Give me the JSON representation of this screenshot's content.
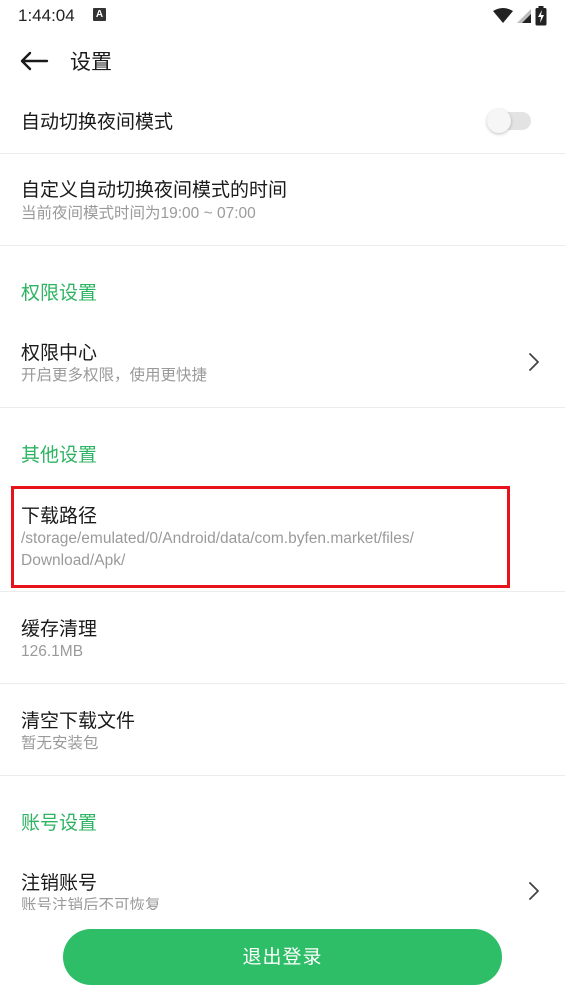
{
  "status_bar": {
    "time": "1:44:04",
    "a_icon_label": "A",
    "icons": [
      "wifi-icon",
      "signal-icon",
      "battery-charging-icon"
    ]
  },
  "header": {
    "title": "设置",
    "back_icon": "arrow-left-icon"
  },
  "rows": {
    "night_mode": {
      "title": "自动切换夜间模式",
      "toggle_on": false
    },
    "night_time": {
      "title": "自定义自动切换夜间模式的时间",
      "subtitle": "当前夜间模式时间为19:00 ~ 07:00"
    },
    "permission_section": "权限设置",
    "permission_center": {
      "title": "权限中心",
      "subtitle": "开启更多权限，使用更快捷"
    },
    "other_section": "其他设置",
    "download_path": {
      "title": "下载路径",
      "subtitle_line1": "/storage/emulated/0/Android/data/com.byfen.market/files/",
      "subtitle_line2": "Download/Apk/"
    },
    "cache": {
      "title": "缓存清理",
      "subtitle": "126.1MB"
    },
    "clear_downloads": {
      "title": "清空下载文件",
      "subtitle": "暂无安装包"
    },
    "account_section": "账号设置",
    "deregister": {
      "title": "注销账号",
      "subtitle": "账号注销后不可恢复"
    }
  },
  "logout_button": "退出登录",
  "colors": {
    "accent_green": "#2db462",
    "button_green": "#2dbe67",
    "highlight_red": "#e8121a",
    "subtitle_gray": "#9a9a9a"
  }
}
